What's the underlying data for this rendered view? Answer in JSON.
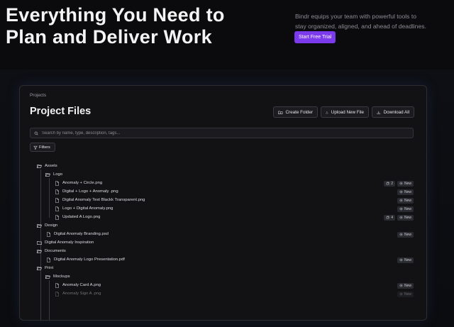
{
  "hero": {
    "title_line1": "Everything You Need to",
    "title_line2": "Plan and Deliver Work",
    "desc_line1": "Bindr equips your team with powerful tools to",
    "desc_line2": "stay organized, aligned, and ahead of deadlines.",
    "cta": "Start Free Trial"
  },
  "accent": "#7c3aed",
  "panel": {
    "breadcrumb": "Projects",
    "title": "Project Files",
    "buttons": {
      "create_folder": "Create Folder",
      "upload_file": "Upload New File",
      "download_all": "Download All"
    },
    "search_placeholder": "Search by name, type, description, tags...",
    "filters": "Filters"
  },
  "tree": [
    {
      "kind": "folder",
      "name": "Assets"
    },
    {
      "kind": "folder",
      "name": "Logo"
    },
    {
      "kind": "file",
      "name": "Anomaly + Circle.png",
      "count": "2",
      "badge": "New"
    },
    {
      "kind": "file",
      "name": "Digital + Logo + Anomaly .png",
      "badge": "New"
    },
    {
      "kind": "file",
      "name": "Digital Anomaly Text Blackk Transparent.png",
      "badge": "New"
    },
    {
      "kind": "file",
      "name": "Logo + Digital Anomaly.png",
      "badge": "New"
    },
    {
      "kind": "file",
      "name": "Updated A Logo.png",
      "count": "4",
      "badge": "New"
    },
    {
      "kind": "folder",
      "name": "Design"
    },
    {
      "kind": "file",
      "name": "Digital Anomaly Branding.psd",
      "badge": "New"
    },
    {
      "kind": "folder",
      "name": "Digital Anomaly Inspiration"
    },
    {
      "kind": "folder",
      "name": "Documents"
    },
    {
      "kind": "file",
      "name": "Digital Anomaly Logo Presentation.pdf",
      "badge": "New"
    },
    {
      "kind": "folder",
      "name": "Print"
    },
    {
      "kind": "folder",
      "name": "Mockups"
    },
    {
      "kind": "file",
      "name": "Anomaly Card A.png",
      "badge": "New"
    },
    {
      "kind": "file",
      "name": "Anomaly Sign A .png",
      "badge": "New"
    }
  ]
}
